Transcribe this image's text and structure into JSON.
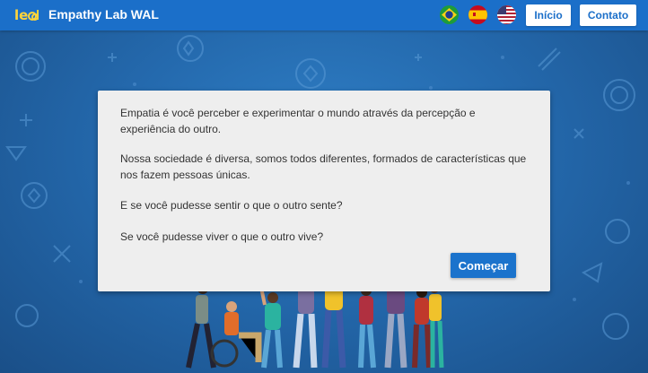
{
  "header": {
    "logo_text": "lead",
    "title": "Empathy Lab WAL",
    "flags": [
      {
        "name": "brazil-flag"
      },
      {
        "name": "spain-flag"
      },
      {
        "name": "usa-flag"
      }
    ],
    "nav": {
      "home_label": "Início",
      "contact_label": "Contato"
    }
  },
  "intro": {
    "paragraphs": [
      "Empatia é você perceber e experimentar o mundo através da percepção e experiência do outro.",
      "Nossa sociedade é diversa, somos todos diferentes, formados de características que nos fazem pessoas únicas.",
      "E se você pudesse sentir o que o outro sente?",
      "Se você pudesse viver o que o outro vive?"
    ],
    "start_label": "Começar"
  },
  "colors": {
    "header_bg": "#1b6fc9",
    "background": "#2469ad",
    "button_bg": "#1b73cc",
    "card_bg": "#eeeeee"
  }
}
